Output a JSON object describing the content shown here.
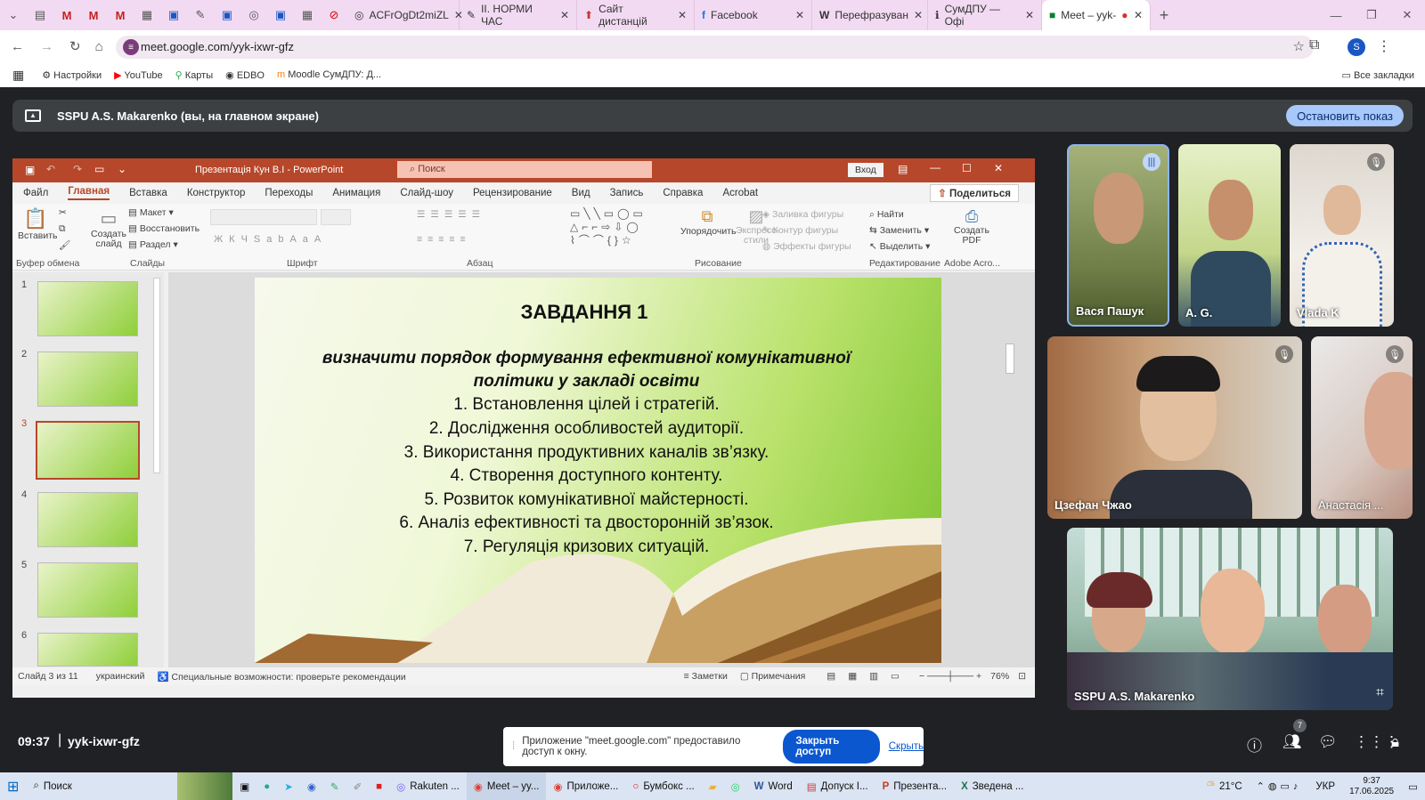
{
  "browser": {
    "tabs": [
      {
        "label": "ACFrOgDt2miZL"
      },
      {
        "label": "ІІ. НОРМИ ЧАС"
      },
      {
        "label": "Сайт дистанцій"
      },
      {
        "label": "Facebook"
      },
      {
        "label": "Перефразуван"
      },
      {
        "label": "СумДПУ — Офі"
      },
      {
        "label": "Meet – yyk-"
      }
    ],
    "url": "meet.google.com/yyk-ixwr-gfz",
    "profile_initial": "S",
    "bookmarks": [
      "Настройки",
      "YouTube",
      "Карты",
      "EDBO",
      "Moodle СумДПУ: Д..."
    ],
    "all_bookmarks": "Все закладки"
  },
  "meet": {
    "share_banner": "SSPU A.S. Makarenko (вы, на главном экране)",
    "stop_button": "Остановить показ",
    "time": "09:37",
    "meeting_code": "yyk-ixwr-gfz",
    "people_count": "7",
    "toast_text": "Приложение \"meet.google.com\" предоставило доступ к окну.",
    "toast_stop": "Закрыть доступ",
    "toast_hide": "Скрыть",
    "participants": [
      {
        "name": "Вася Пашук"
      },
      {
        "name": "A. G."
      },
      {
        "name": "Vlada K"
      },
      {
        "name": "Цзефан Чжао"
      },
      {
        "name": "Анастасія ..."
      },
      {
        "name": "SSPU A.S. Makarenko"
      }
    ]
  },
  "ppt": {
    "title": "Презентація Кун В.І  -  PowerPoint",
    "search": "Поиск",
    "login": "Вход",
    "menu": [
      "Файл",
      "Главная",
      "Вставка",
      "Конструктор",
      "Переходы",
      "Анимация",
      "Слайд-шоу",
      "Рецензирование",
      "Вид",
      "Запись",
      "Справка",
      "Acrobat"
    ],
    "share": "Поделиться",
    "groups": [
      "Буфер обмена",
      "Слайды",
      "Шрифт",
      "Абзац",
      "Рисование",
      "Редактирование",
      "Adobe Acro..."
    ],
    "ribbon": {
      "paste": "Вставить",
      "new_slide": "Создать слайд",
      "layout": "Макет",
      "reset": "Восстановить",
      "section": "Раздел",
      "arrange": "Упорядочить",
      "quick_styles": "Экспресс-стили",
      "fill": "Заливка фигуры",
      "outline": "Контур фигуры",
      "effects": "Эффекты фигуры",
      "find": "Найти",
      "replace": "Заменить",
      "select": "Выделить",
      "create_pdf": "Создать PDF"
    },
    "thumb_numbers": [
      "1",
      "2",
      "3",
      "4",
      "5",
      "6"
    ],
    "slide": {
      "heading": "ЗАВДАННЯ 1",
      "subtitle_1": "визначити порядок формування ефективної комунікативної",
      "subtitle_2": "політики у закладі освіти",
      "items": [
        "1.   Встановлення цілей і стратегій.",
        "2.   Дослідження особливостей аудиторії.",
        "3.   Використання продуктивних каналів зв’язку.",
        "4.   Створення доступного контенту.",
        "5.   Розвиток комунікативної майстерності.",
        "6.   Аналіз ефективності та двосторонній зв’язок.",
        "7.   Регуляція кризових ситуацій."
      ]
    },
    "status": {
      "slide": "Слайд 3 из 11",
      "language": "украинский",
      "accessibility": "Специальные возможности: проверьте рекомендации",
      "notes": "Заметки",
      "comments": "Примечания",
      "zoom": "76%"
    }
  },
  "taskbar": {
    "search": "Поиск",
    "apps": [
      "Rakuten ...",
      "Meet – yy...",
      "Приложе...",
      "Бумбокс ...",
      "Word",
      "Допуск І...",
      "Презента...",
      "Зведена ..."
    ],
    "weather": "21°C",
    "lang": "УКР",
    "time": "9:37",
    "date": "17.06.2025"
  }
}
